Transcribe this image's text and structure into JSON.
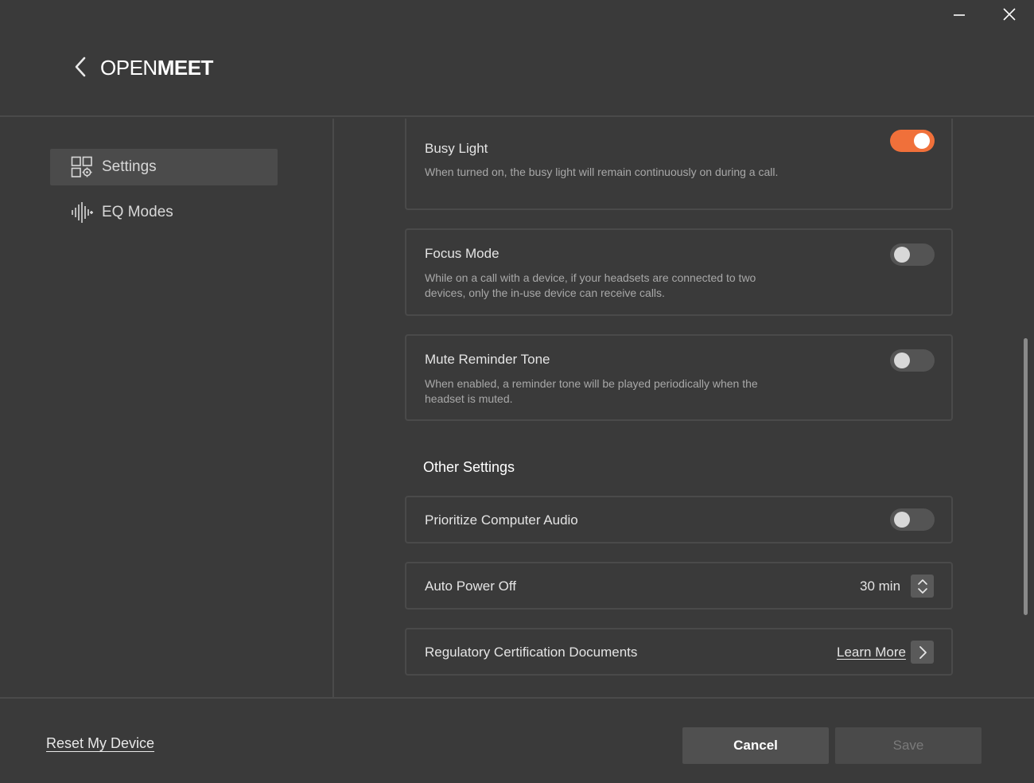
{
  "window": {
    "minimize_icon": "minimize-icon",
    "close_icon": "close-icon"
  },
  "header": {
    "back_icon": "chevron-left-icon",
    "logo_light": "OPEN",
    "logo_bold": "MEET"
  },
  "sidebar": {
    "items": [
      {
        "label": "Settings",
        "icon": "settings-grid-icon",
        "active": true
      },
      {
        "label": "EQ Modes",
        "icon": "waveform-icon",
        "active": false
      }
    ]
  },
  "main": {
    "busy_light": {
      "title": "Busy Light",
      "description": "When turned on, the busy light will remain continuously on during a call.",
      "enabled": true
    },
    "focus_mode": {
      "title": "Focus Mode",
      "description": "While on a call with a device, if your headsets are connected to two devices, only the in-use device can receive calls.",
      "enabled": false
    },
    "mute_reminder": {
      "title": "Mute Reminder Tone",
      "description": "When enabled, a reminder tone will be played periodically when the headset is muted.",
      "enabled": false
    },
    "other_settings_title": "Other Settings",
    "prioritize_audio": {
      "title": "Prioritize Computer Audio",
      "enabled": false
    },
    "auto_power_off": {
      "title": "Auto Power Off",
      "value": "30 min"
    },
    "regulatory": {
      "title": "Regulatory Certification Documents",
      "link": "Learn More"
    }
  },
  "footer": {
    "reset_label": "Reset My Device",
    "cancel_label": "Cancel",
    "save_label": "Save"
  },
  "colors": {
    "background": "#3a3a3a",
    "accent": "#f0703a",
    "border": "#4a4a4a"
  }
}
